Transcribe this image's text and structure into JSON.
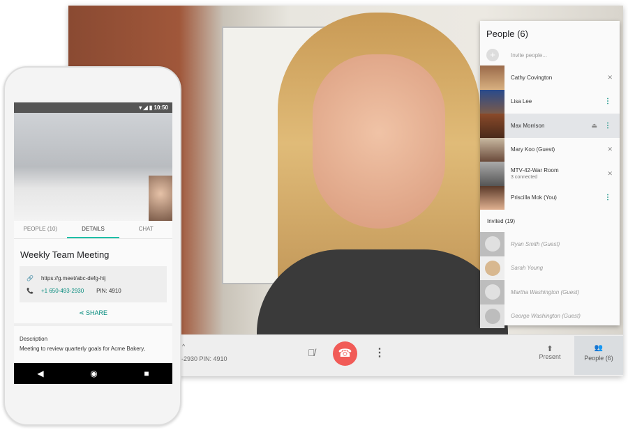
{
  "desktop": {
    "control_bar": {
      "dial_info": "3-2930 PIN: 4910",
      "present_label": "Present",
      "people_label": "People (6)"
    },
    "people_panel": {
      "title": "People (6)",
      "invite_placeholder": "Invite people...",
      "participants": [
        {
          "name": "Cathy Covington",
          "status": "muted"
        },
        {
          "name": "Lisa Lee",
          "status": "more"
        },
        {
          "name": "Max Morrison",
          "status": "presenting",
          "selected": true
        },
        {
          "name": "Mary Koo (Guest)",
          "status": "muted"
        },
        {
          "name": "MTV-42-War Room",
          "sub": "3 connected",
          "status": "muted"
        },
        {
          "name": "Priscilla Mok (You)",
          "status": "more"
        }
      ],
      "invited_header": "Invited (19)",
      "invited": [
        "Ryan Smith (Guest)",
        "Sarah Young",
        "Martha Washington (Guest)",
        "George Washington (Guest)"
      ]
    }
  },
  "phone": {
    "time": "10:50",
    "tabs": [
      "PEOPLE (10)",
      "DETAILS",
      "CHAT"
    ],
    "active_tab": "DETAILS",
    "meeting_title": "Weekly Team Meeting",
    "link": "https://g.meet/abc-defg-hij",
    "phone_number": "+1 650-493-2930",
    "pin": "PIN: 4910",
    "share_label": "SHARE",
    "description_header": "Description",
    "description": "Meeting to review quarterly goals for Acme Bakery,"
  },
  "colors": {
    "accent": "#00897b",
    "hangup": "#f15b57",
    "tab_underline": "#1fbfa7"
  }
}
